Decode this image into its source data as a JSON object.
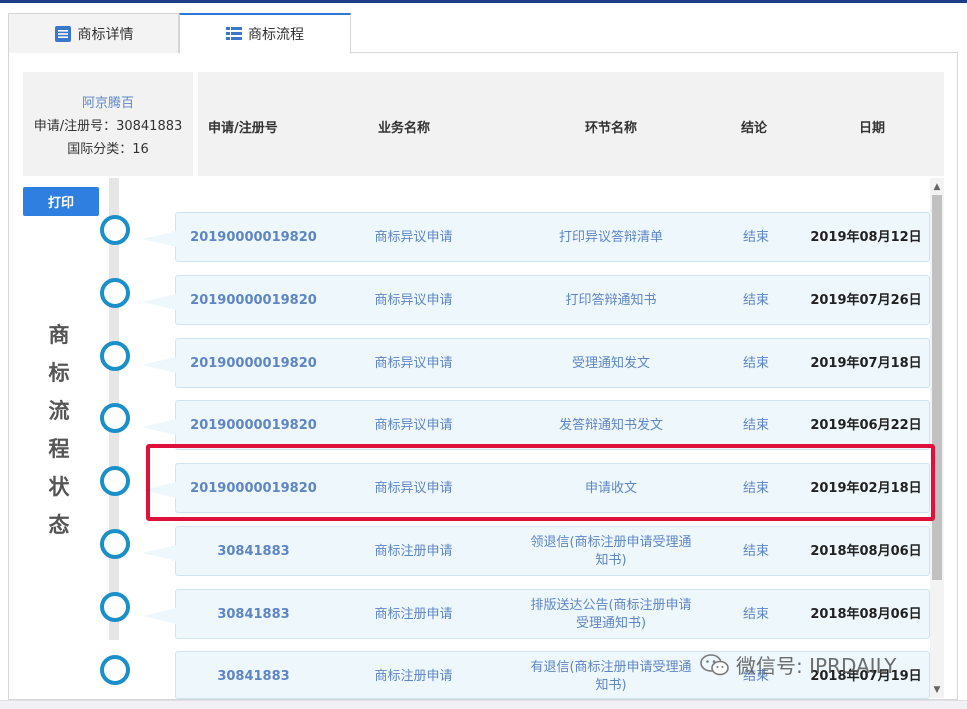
{
  "tabs": [
    {
      "label": "商标详情",
      "icon": "list-icon"
    },
    {
      "label": "商标流程",
      "icon": "grid-list-icon"
    }
  ],
  "info": {
    "name": "阿京腾百",
    "reg_line": "申请/注册号：30841883",
    "class_line": "国际分类：16"
  },
  "header": {
    "col1": "申请/注册号",
    "col2": "业务名称",
    "col3": "环节名称",
    "col4": "结论",
    "col5": "日期"
  },
  "print_label": "打印",
  "status_label": [
    "商",
    "标",
    "流",
    "程",
    "状",
    "态"
  ],
  "rows": [
    {
      "number": "20190000019820",
      "business": "商标异议申请",
      "step": "打印异议答辩清单",
      "result": "结束",
      "date": "2019年08月12日"
    },
    {
      "number": "20190000019820",
      "business": "商标异议申请",
      "step": "打印答辩通知书",
      "result": "结束",
      "date": "2019年07月26日"
    },
    {
      "number": "20190000019820",
      "business": "商标异议申请",
      "step": "受理通知发文",
      "result": "结束",
      "date": "2019年07月18日"
    },
    {
      "number": "20190000019820",
      "business": "商标异议申请",
      "step": "发答辩通知书发文",
      "result": "结束",
      "date": "2019年06月22日"
    },
    {
      "number": "20190000019820",
      "business": "商标异议申请",
      "step": "申请收文",
      "result": "结束",
      "date": "2019年02月18日"
    },
    {
      "number": "30841883",
      "business": "商标注册申请",
      "step": "领退信(商标注册申请受理通知书)",
      "result": "结束",
      "date": "2018年08月06日"
    },
    {
      "number": "30841883",
      "business": "商标注册申请",
      "step": "排版送达公告(商标注册申请受理通知书)",
      "result": "结束",
      "date": "2018年08月06日"
    },
    {
      "number": "30841883",
      "business": "商标注册申请",
      "step": "有退信(商标注册申请受理通知书)",
      "result": "结束",
      "date": "2018年07月19日"
    }
  ],
  "watermark": "微信号: IPRDAILY",
  "colors": {
    "accent": "#2f7fe0",
    "highlight": "#e0103c",
    "circle": "#1a8fc8"
  }
}
